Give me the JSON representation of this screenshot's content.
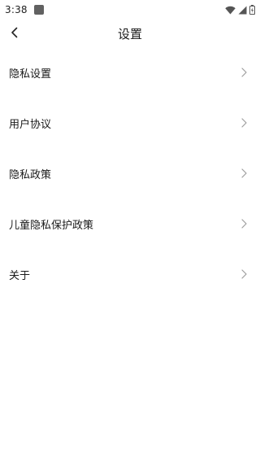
{
  "status_bar": {
    "time": "3:38",
    "icons": [
      "notification-square-icon",
      "wifi-icon",
      "cell-signal-icon",
      "battery-charging-icon"
    ]
  },
  "header": {
    "title": "设置",
    "back_icon": "chevron-left-icon"
  },
  "settings": {
    "items": [
      {
        "label": "隐私设置"
      },
      {
        "label": "用户协议"
      },
      {
        "label": "隐私政策"
      },
      {
        "label": "儿童隐私保护政策"
      },
      {
        "label": "关于"
      }
    ],
    "item_icon": "chevron-right-icon"
  },
  "colors": {
    "background": "#ffffff",
    "text": "#1a1a1a",
    "chevron": "#9e9e9e"
  }
}
